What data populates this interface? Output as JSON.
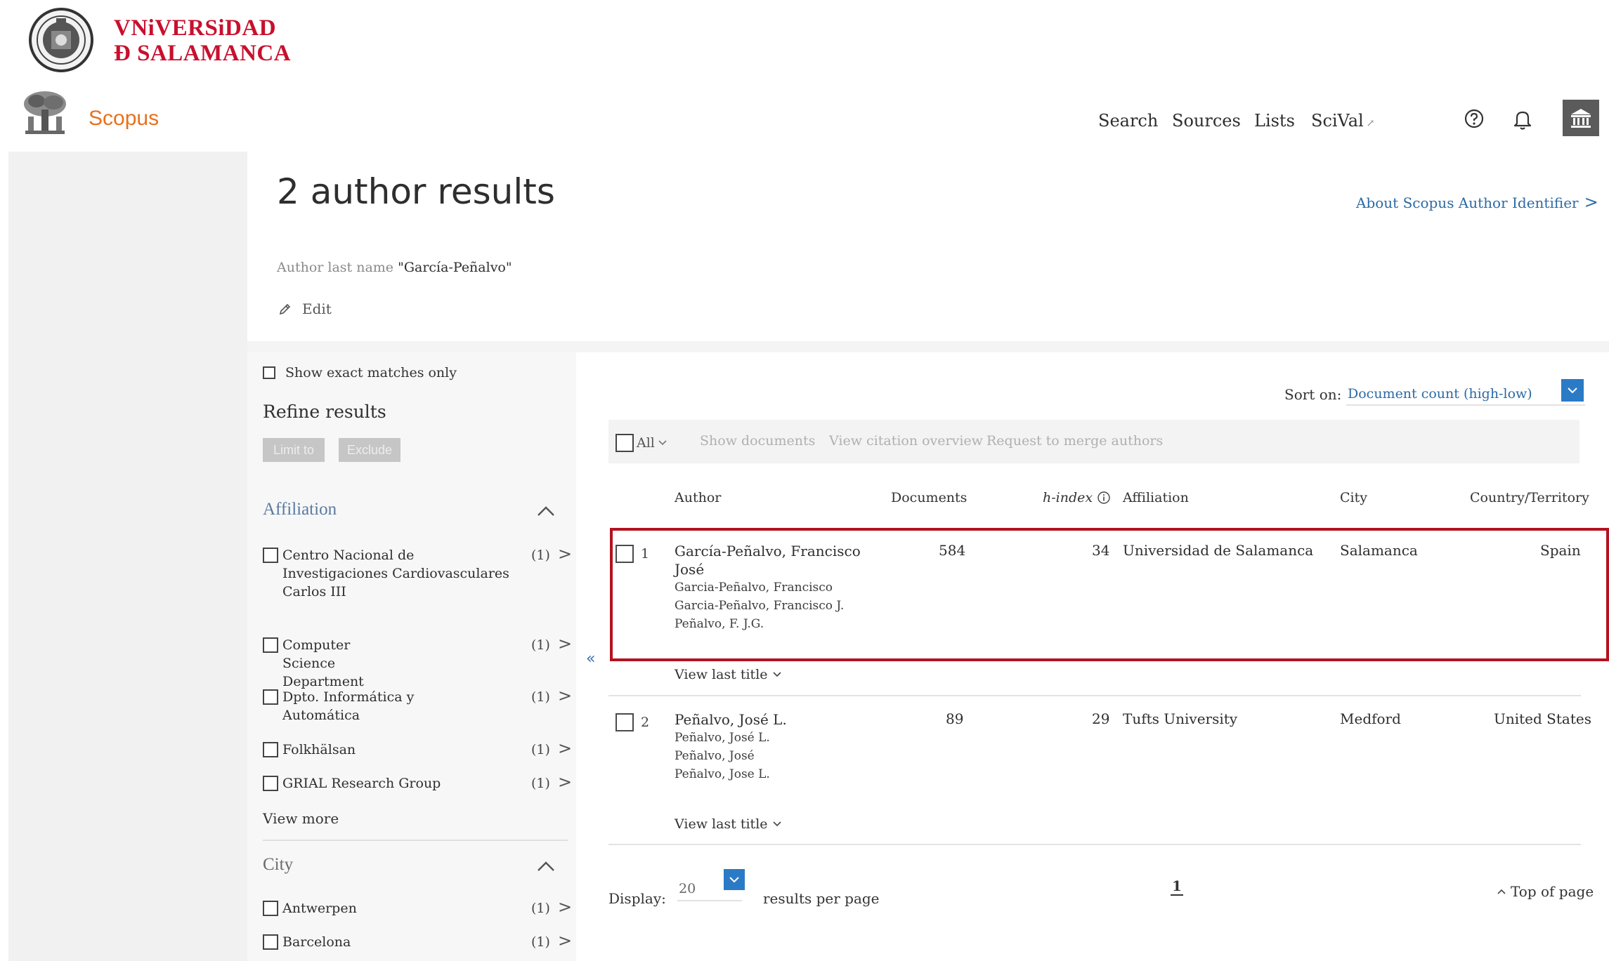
{
  "university": {
    "name_line1": "VNiVERSiDAD",
    "name_line2": "Ð SALAMANCA"
  },
  "header": {
    "brand": "Scopus",
    "nav": {
      "search": "Search",
      "sources": "Sources",
      "lists": "Lists",
      "scival": "SciVal",
      "scival_arrow": "↗"
    }
  },
  "page": {
    "title": "2 author results",
    "about_link": "About Scopus Author Identifier",
    "about_chevron": ">",
    "query_label": "Author last name",
    "query_value": "\"García-Peñalvo\"",
    "edit_label": "Edit"
  },
  "refine": {
    "exact_matches_label": "Show exact matches only",
    "title": "Refine results",
    "limit_to": "Limit to",
    "exclude": "Exclude",
    "affiliation": {
      "heading": "Affiliation",
      "items": [
        {
          "label": "Centro Nacional de Investigaciones Cardiovasculares Carlos III",
          "count": "(1)"
        },
        {
          "label": "Computer Science Department",
          "count": "(1)"
        },
        {
          "label": "Dpto. Informática y Automática",
          "count": "(1)"
        },
        {
          "label": "Folkhälsan",
          "count": "(1)"
        },
        {
          "label": "GRIAL Research Group",
          "count": "(1)"
        }
      ],
      "view_more": "View more"
    },
    "city": {
      "heading": "City",
      "items": [
        {
          "label": "Antwerpen",
          "count": "(1)"
        },
        {
          "label": "Barcelona",
          "count": "(1)"
        }
      ]
    },
    "go_glyph": ">",
    "collapse_glyph": "«"
  },
  "results": {
    "sort_label": "Sort on:",
    "sort_value": "Document count (high-low)",
    "toolbar": {
      "all_label": "All",
      "show_documents": "Show documents",
      "view_citation_overview": "View citation overview",
      "request_merge": "Request to merge authors"
    },
    "columns": {
      "author": "Author",
      "documents": "Documents",
      "hindex": "h-index",
      "affiliation": "Affiliation",
      "city": "City",
      "country": "Country/Territory"
    },
    "rows": [
      {
        "num": "1",
        "name_line1": "García-Peñalvo, Francisco",
        "name_line2": "José",
        "variants": [
          "Garcia-Peñalvo, Francisco",
          "Garcia-Peñalvo, Francisco J.",
          "Peñalvo, F. J.G."
        ],
        "documents": "584",
        "hindex": "34",
        "affiliation": "Universidad de Salamanca",
        "city": "Salamanca",
        "country": "Spain",
        "view_last_title": "View last title"
      },
      {
        "num": "2",
        "name_line1": "Peñalvo, José L.",
        "variants": [
          "Peñalvo, José L.",
          "Peñalvo, José",
          "Peñalvo, Jose L."
        ],
        "documents": "89",
        "hindex": "29",
        "affiliation": "Tufts University",
        "city": "Medford",
        "country": "United States",
        "view_last_title": "View last title"
      }
    ],
    "display_label": "Display:",
    "display_value": "20",
    "per_page_label": "results per page",
    "current_page": "1",
    "top_of_page": "Top of page"
  },
  "colors": {
    "brand_orange": "#e9711c",
    "uni_red": "#c8102e",
    "link_blue": "#2c6aa5",
    "highlight_red": "#b3121f"
  }
}
